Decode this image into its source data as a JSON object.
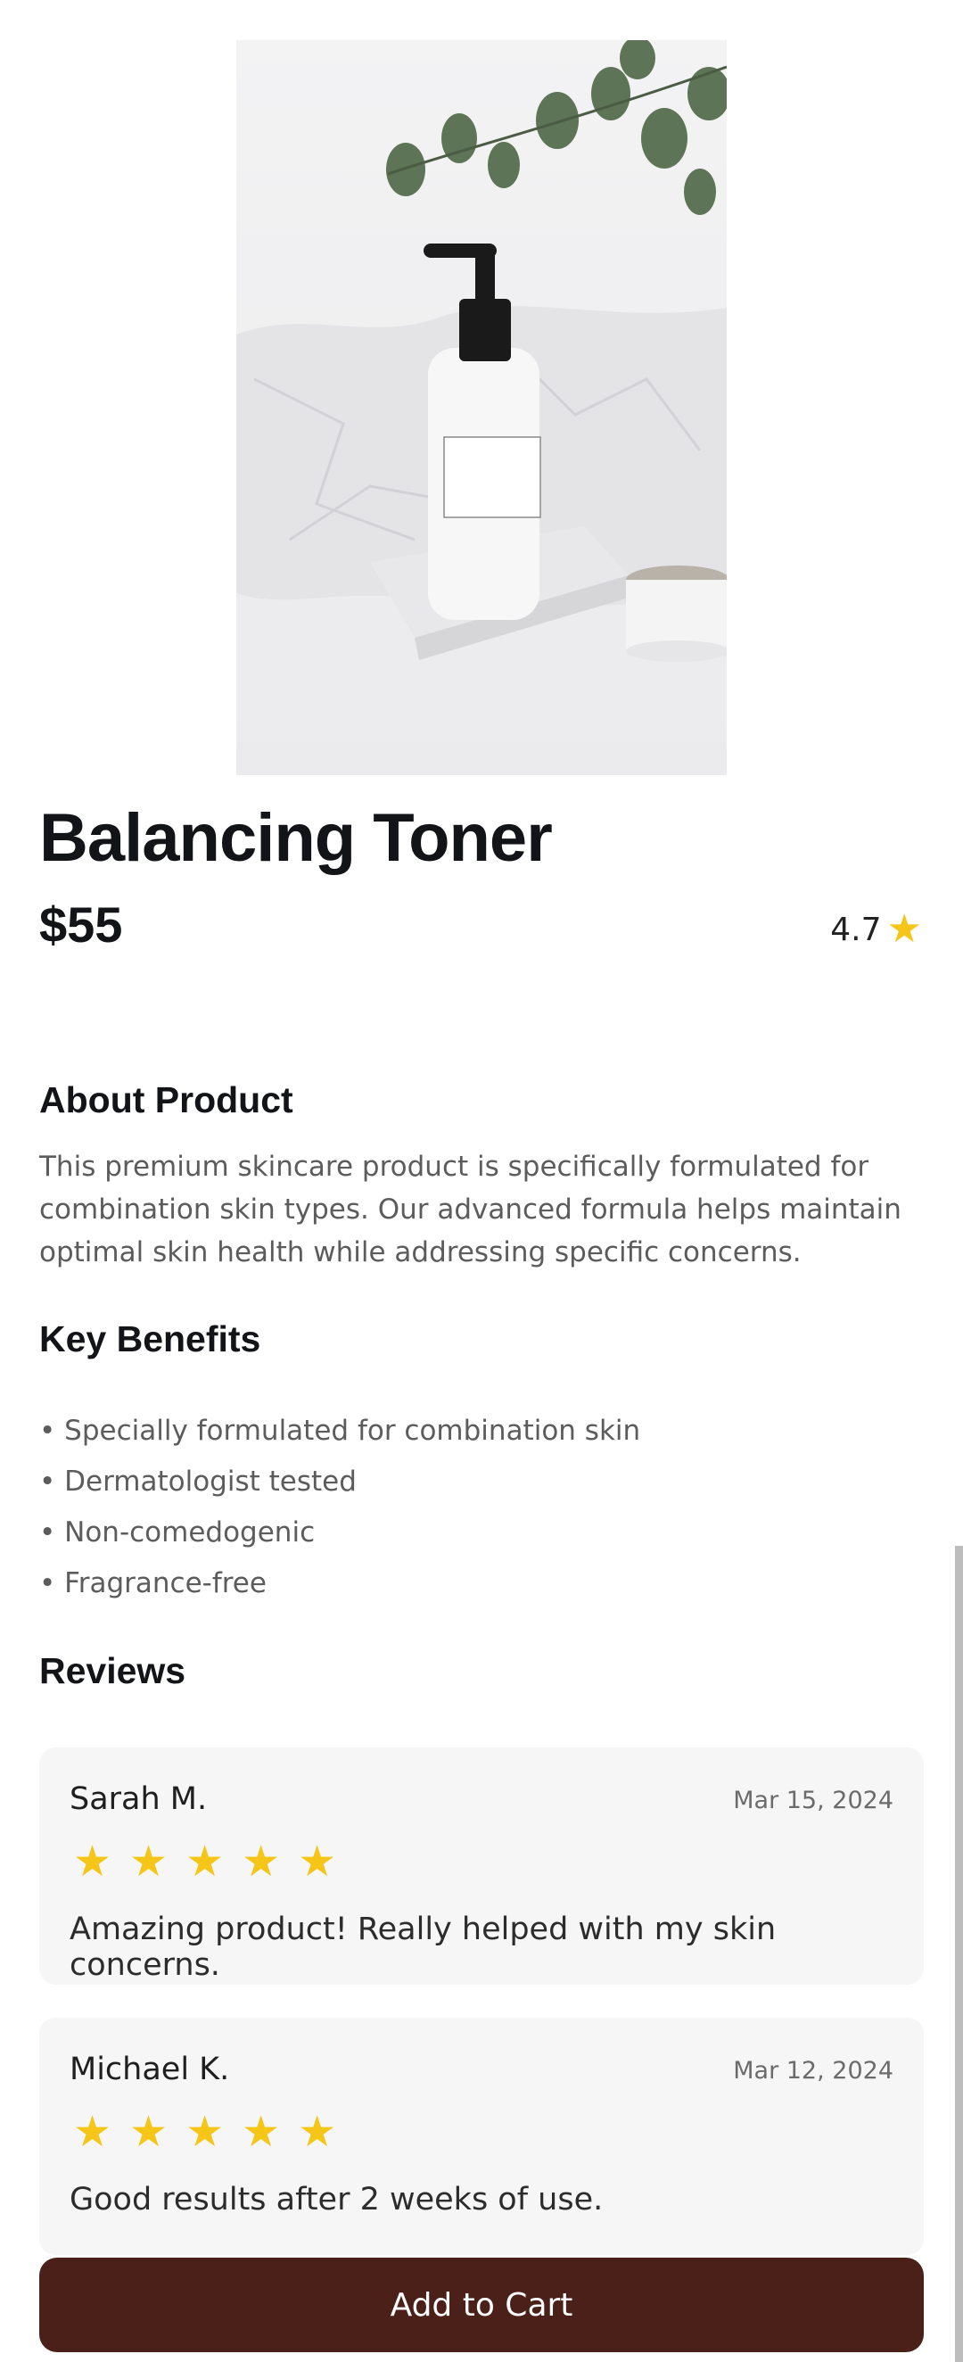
{
  "product": {
    "name": "Balancing Toner",
    "price": "$55",
    "rating": "4.7"
  },
  "about": {
    "heading": "About Product",
    "text": "This premium skincare product is specifically formulated for combination skin types. Our advanced formula helps maintain optimal skin health while addressing specific concerns."
  },
  "benefits": {
    "heading": "Key Benefits",
    "items": [
      "Specially formulated for combination skin",
      "Dermatologist tested",
      "Non-comedogenic",
      "Fragrance-free"
    ]
  },
  "reviews": {
    "heading": "Reviews",
    "items": [
      {
        "author": "Sarah M.",
        "date": "Mar 15, 2024",
        "stars": 5,
        "text": "Amazing product! Really helped with my skin concerns."
      },
      {
        "author": "Michael K.",
        "date": "Mar 12, 2024",
        "stars": 5,
        "text": "Good results after 2 weeks of use."
      }
    ]
  },
  "actions": {
    "add_to_cart": "Add to Cart"
  },
  "colors": {
    "star": "#f5c518",
    "cart_button": "#4a2019",
    "review_card": "#f6f6f6"
  }
}
